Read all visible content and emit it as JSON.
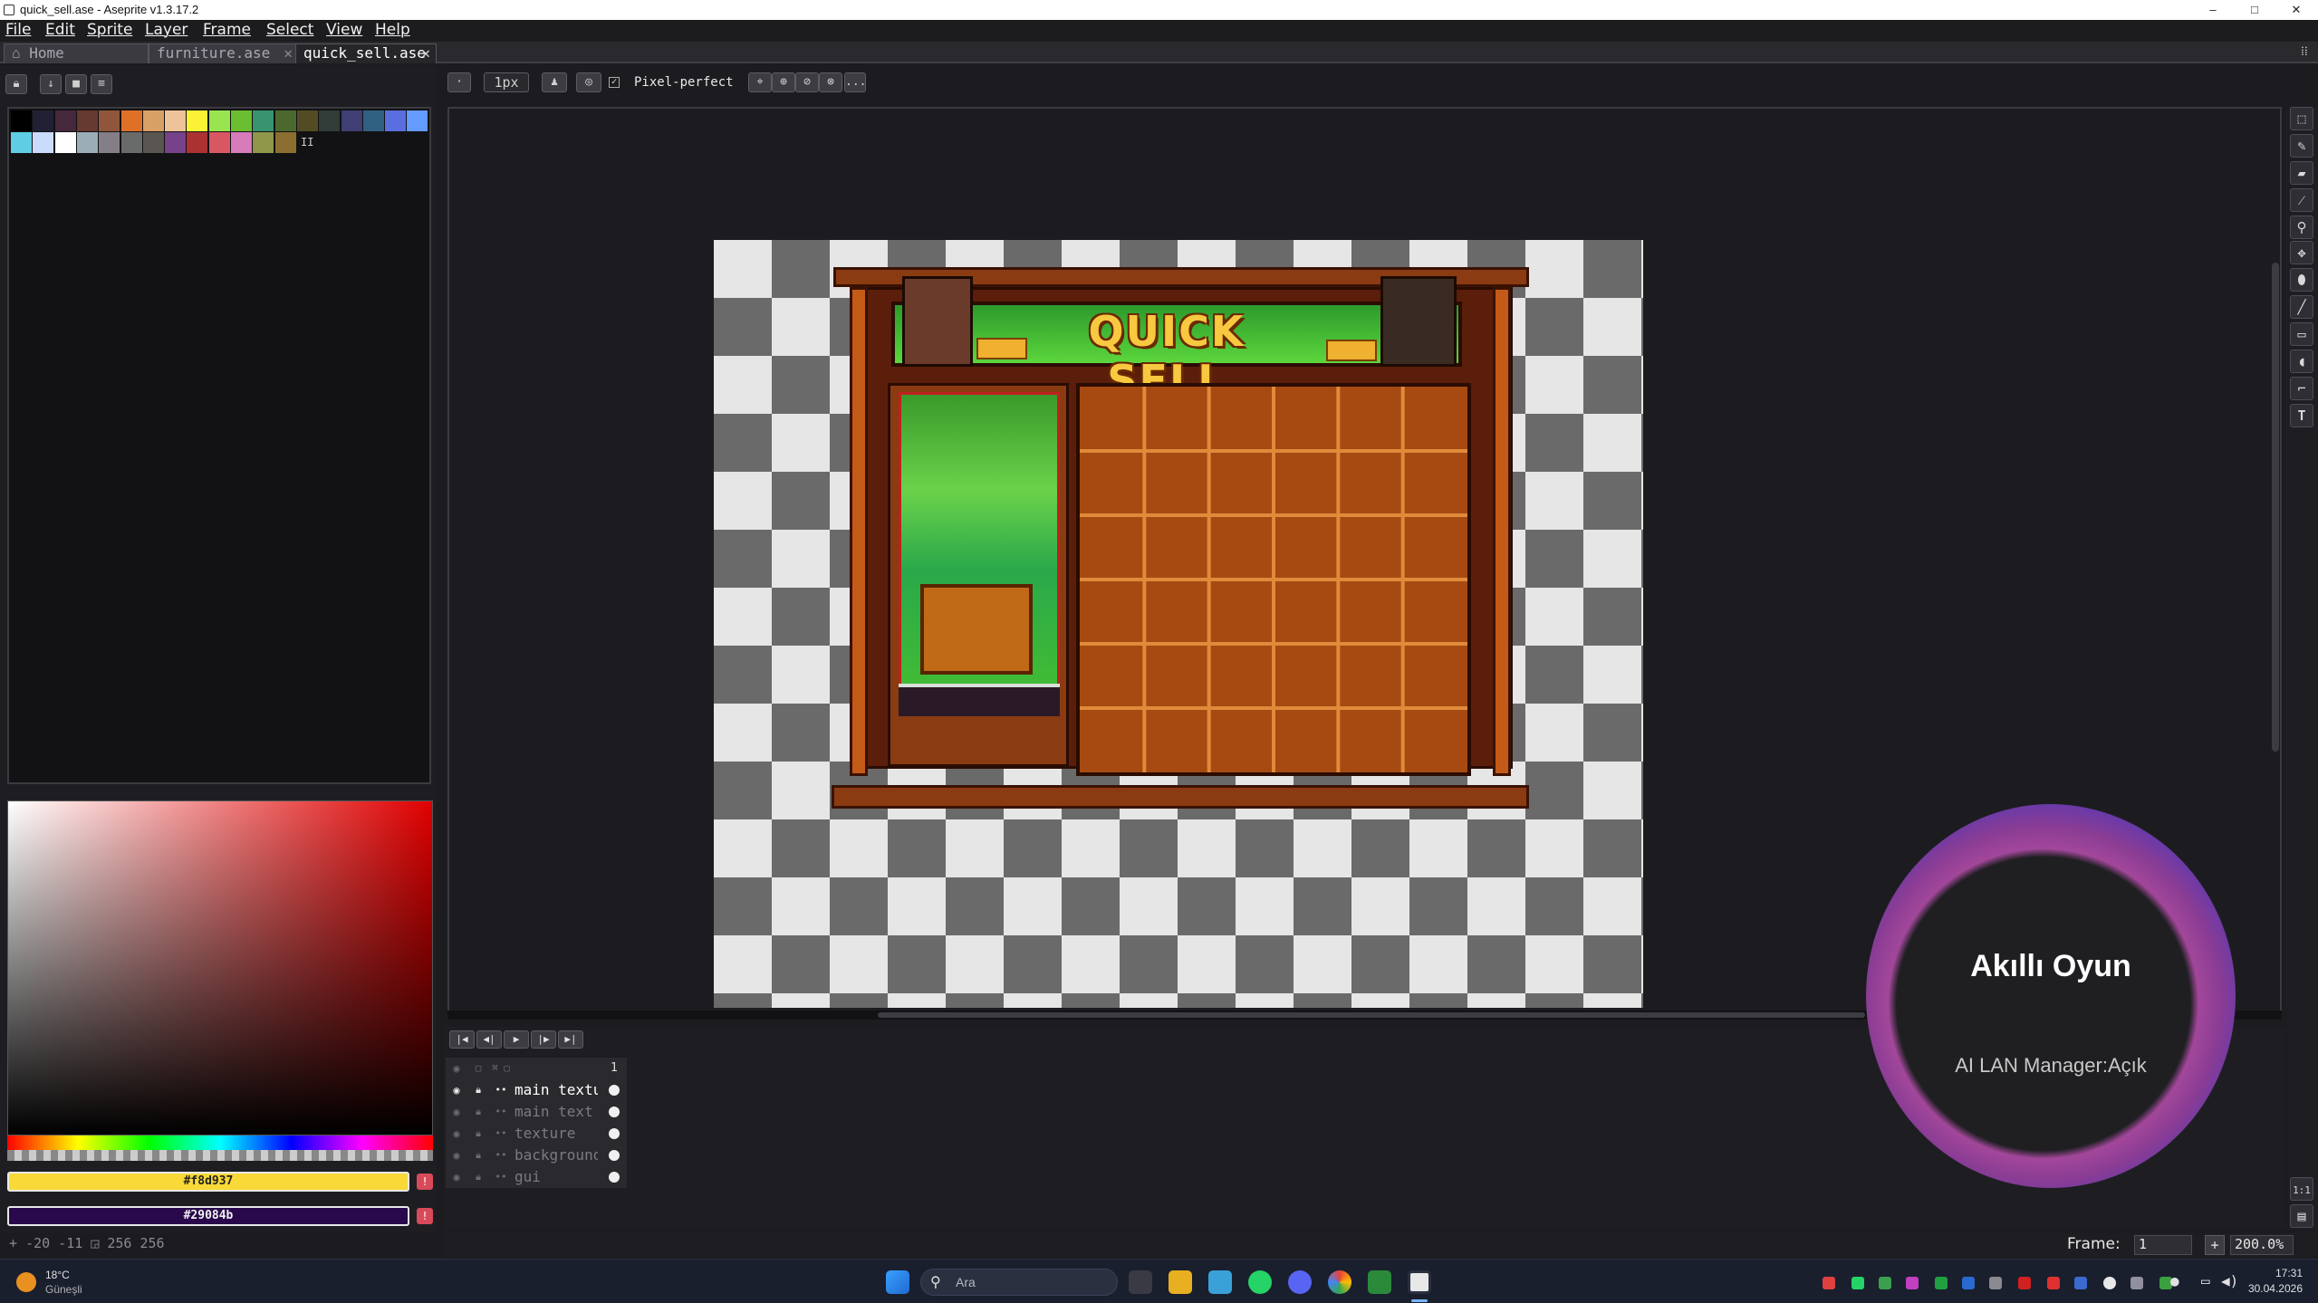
{
  "window": {
    "title": "quick_sell.ase - Aseprite v1.3.17.2",
    "controls": [
      "–",
      "□",
      "✕"
    ]
  },
  "menu": [
    "File",
    "Edit",
    "Sprite",
    "Layer",
    "Frame",
    "Select",
    "View",
    "Help"
  ],
  "tabs": [
    {
      "label": "Home",
      "icon": "home-icon",
      "active": false
    },
    {
      "label": "furniture.ase",
      "active": false
    },
    {
      "label": "quick_sell.ase",
      "active": true
    }
  ],
  "toolbar": {
    "brush_size": "1px",
    "pixel_perfect_label": "Pixel-perfect",
    "more": "..."
  },
  "palette": {
    "colors": [
      "#000000",
      "#222034",
      "#45283c",
      "#663931",
      "#8f563b",
      "#df7126",
      "#d9a066",
      "#eec39a",
      "#fbf236",
      "#99e550",
      "#6abe30",
      "#37946e",
      "#4b692f",
      "#524b24",
      "#323c39",
      "#3f3f74",
      "#306082",
      "#5b6ee1",
      "#639bff",
      "#5fcde4",
      "#cbdbfc",
      "#ffffff",
      "#9badb7",
      "#847e87",
      "#696a6a",
      "#595652",
      "#76428a",
      "#ac3232",
      "#d95763",
      "#d77bba",
      "#8f974a",
      "#8a6f30"
    ],
    "more_marker": "II"
  },
  "colors": {
    "foreground": {
      "hex": "#f8d937",
      "label": "#f8d937"
    },
    "background": {
      "hex": "#29084b",
      "label": "#29084b"
    }
  },
  "status": {
    "coords": "-20 -11",
    "size": "256 256"
  },
  "sprite": {
    "banner_text": "QUICK SELL",
    "grid_columns": 6,
    "grid_rows": 6
  },
  "timeline": {
    "frame_header": "1",
    "layers": [
      {
        "name": "main textur",
        "active": true
      },
      {
        "name": "main text",
        "active": false
      },
      {
        "name": "texture",
        "active": false
      },
      {
        "name": "background",
        "active": false
      },
      {
        "name": "gui",
        "active": false
      }
    ]
  },
  "framebar": {
    "frame_label": "Frame:",
    "frame_value": "1",
    "zoom": "200.0%"
  },
  "overlay": {
    "title": "Akıllı Oyun",
    "subtitle": "AI LAN Manager:Açık"
  },
  "taskbar": {
    "weather_temp": "18°C",
    "weather_text": "Güneşli",
    "search_placeholder": "Ara",
    "time": "17:31",
    "date": "30.04.2026"
  }
}
